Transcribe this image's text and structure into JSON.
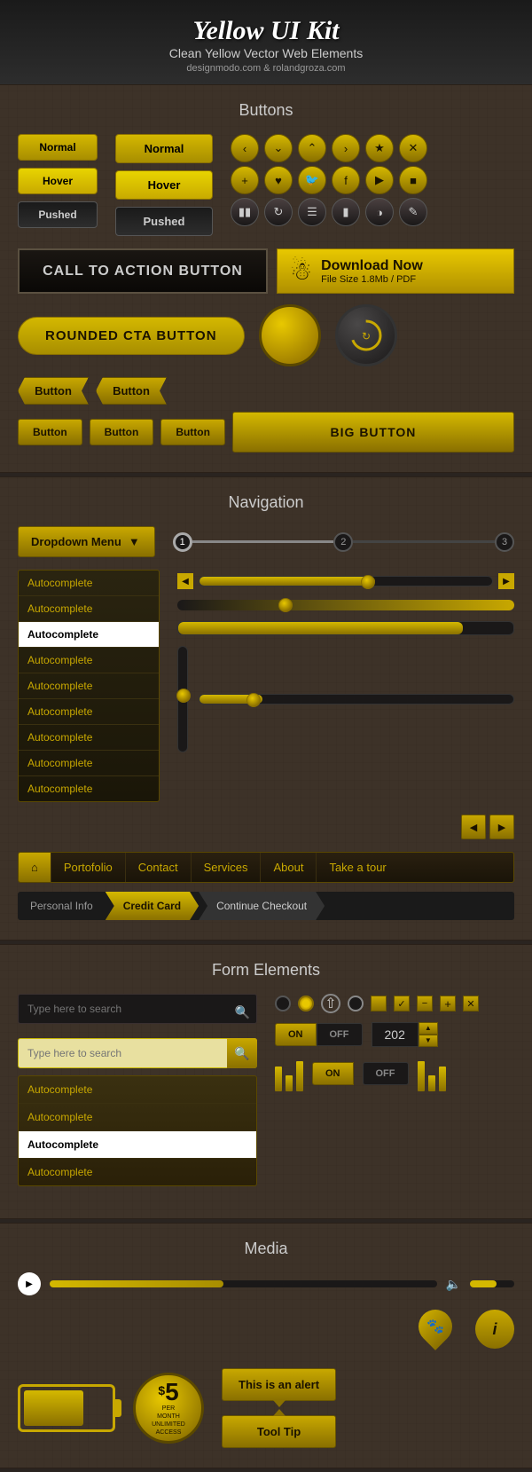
{
  "header": {
    "title": "Yellow UI Kit",
    "subtitle": "Clean Yellow Vector Web Elements",
    "url": "designmodo.com & rolandgroza.com"
  },
  "sections": {
    "buttons": {
      "title": "Buttons",
      "normal1": "Normal",
      "hover1": "Hover",
      "pushed1": "Pushed",
      "normal2": "Normal",
      "hover2": "Hover",
      "pushed2": "Pushed",
      "cta": "CALL TO ACTION BUTTON",
      "download_title": "Download Now",
      "download_sub": "File Size 1.8Mb / PDF",
      "rounded_cta": "ROUNDED CTA BUTTON",
      "button": "Button",
      "big_button": "BIG BUTTON"
    },
    "navigation": {
      "title": "Navigation",
      "dropdown": "Dropdown Menu",
      "step1": "1",
      "step2": "2",
      "step3": "3",
      "autocomplete_items": [
        "Autocomplete",
        "Autocomplete",
        "Autocomplete",
        "Autocomplete",
        "Autocomplete",
        "Autocomplete",
        "Autocomplete",
        "Autocomplete",
        "Autocomplete"
      ],
      "selected_index": 2,
      "nav_items": [
        "",
        "Portofolio",
        "Contact",
        "Services",
        "About",
        "Take a tour"
      ],
      "breadcrumb": [
        "Personal Info",
        "Credit Card",
        "Continue Checkout"
      ]
    },
    "form": {
      "title": "Form Elements",
      "search_placeholder1": "Type here to search",
      "search_placeholder2": "Type here to search",
      "auto_items": [
        "Autocomplete",
        "Autocomplete",
        "Autocomplete",
        "Autocomplete"
      ],
      "auto_selected": 2,
      "toggle_on": "ON",
      "toggle_off": "OFF",
      "number_value": "202",
      "on_label": "ON",
      "off_label": "OFF"
    },
    "media": {
      "title": "Media",
      "alert_text": "This is an alert",
      "tooltip_text": "Tool Tip",
      "price_amount": "5",
      "price_unit": "MONTH",
      "price_sub": "UNLIMITED\nACCESS"
    }
  }
}
